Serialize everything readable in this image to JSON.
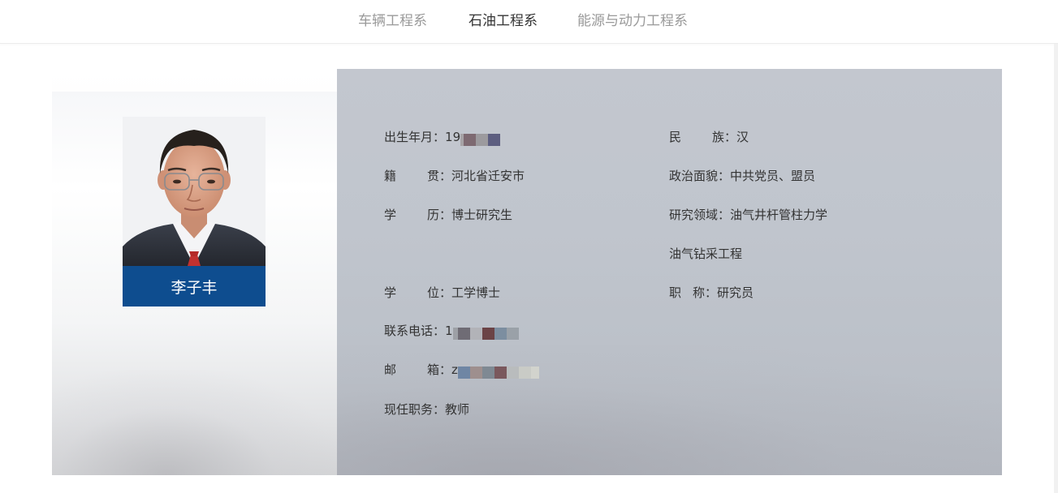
{
  "nav": {
    "items": [
      "车辆工程系",
      "石油工程系",
      "能源与动力工程系"
    ],
    "active_index": 1
  },
  "profile": {
    "name": "李子丰",
    "fields": {
      "birth": {
        "label": "出生年月",
        "value": "19"
      },
      "ethnic": {
        "label": "民族",
        "value": "汉"
      },
      "native": {
        "label": "籍贯",
        "value": "河北省迁安市"
      },
      "political": {
        "label": "政治面貌",
        "value": "中共党员、盟员"
      },
      "education": {
        "label": "学历",
        "value": "博士研究生"
      },
      "research": {
        "label": "研究领域",
        "value": "油气井杆管柱力学",
        "value2": "油气钻采工程"
      },
      "degree": {
        "label": "学位",
        "value": "工学博士"
      },
      "title": {
        "label": "职称",
        "value": "研究员"
      },
      "phone": {
        "label": "联系电话",
        "value": "1"
      },
      "email": {
        "label": "邮箱",
        "value": "z"
      },
      "position": {
        "label": "现任职务",
        "value": "教师"
      }
    },
    "colon": "："
  },
  "colors": {
    "name_bar": "#0e4d8f",
    "panel": "#c1c5cd",
    "nav_active": "#333333",
    "nav_inactive": "#9a9a9a"
  }
}
